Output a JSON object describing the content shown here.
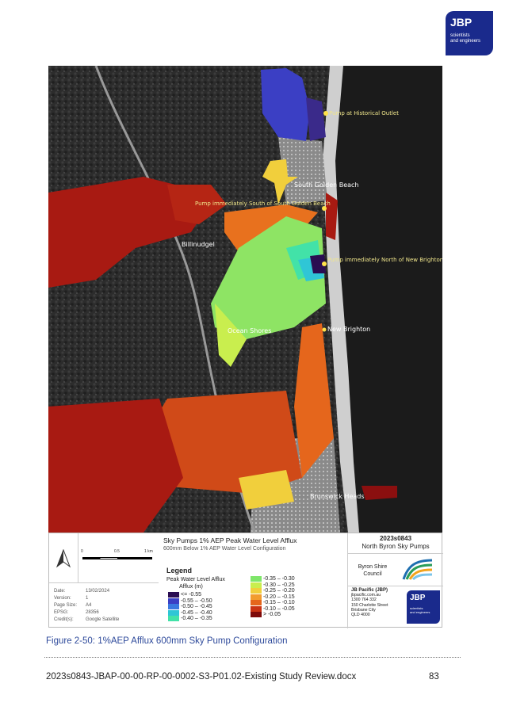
{
  "logo": {
    "big": "JBP",
    "line1": "scientists",
    "line2": "and engineers"
  },
  "map": {
    "place_labels": {
      "pump_historical": "Pump at Historical Outlet",
      "south_golden_beach": "South Golden Beach",
      "pump_south_sgb": "Pump immediately South of South Golden Beach",
      "billinudgel": "Billinudgel",
      "pump_north_nb": "Pump immediately North of New Brighton",
      "ocean_shores": "Ocean Shores",
      "new_brighton": "New Brighton",
      "brunswick_heads": "Brunswick Heads"
    }
  },
  "legend_panel": {
    "scale": {
      "t0": "0",
      "t1": "0.5",
      "t2": "1 km"
    },
    "meta": [
      {
        "k": "Date:",
        "v": "13/02/2024"
      },
      {
        "k": "Version:",
        "v": "1"
      },
      {
        "k": "Page Size:",
        "v": "A4"
      },
      {
        "k": "EPSG:",
        "v": "28356"
      },
      {
        "k": "Credit(s):",
        "v": "Google Satellite"
      }
    ],
    "title": "Sky Pumps 1% AEP Peak Water Level Afflux",
    "subtitle": "600mm Below 1% AEP Water Level Configuration",
    "legend_title": "Legend",
    "legend_sub1": "Peak Water Level Afflux",
    "legend_sub2": "Afflux (m)",
    "classes_left": [
      {
        "label": "<= -0.55",
        "color": "#2a0d52"
      },
      {
        "label": "-0.55 – -0.50",
        "color": "#3b3fc4"
      },
      {
        "label": "-0.50 – -0.45",
        "color": "#3a78e0"
      },
      {
        "label": "-0.45 – -0.40",
        "color": "#2fc6d6"
      },
      {
        "label": "-0.40 – -0.35",
        "color": "#42e2a8"
      }
    ],
    "classes_right": [
      {
        "label": "-0.35 – -0.30",
        "color": "#7fe66a"
      },
      {
        "label": "-0.30 – -0.25",
        "color": "#c9ee4e"
      },
      {
        "label": "-0.25 – -0.20",
        "color": "#f1cf3c"
      },
      {
        "label": "-0.20 – -0.15",
        "color": "#f29c2e"
      },
      {
        "label": "-0.15 – -0.10",
        "color": "#e5661c"
      },
      {
        "label": "-0.10 – -0.05",
        "color": "#c93314"
      },
      {
        "label": "> -0.05",
        "color": "#7e0a0a"
      }
    ],
    "project_number": "2023s0843",
    "project_name": "North Byron Sky Pumps",
    "council_line1": "Byron Shire",
    "council_line2": "Council",
    "jbp": {
      "name": "JB Pacific (JBP)",
      "web": "jbpacific.com.au",
      "phone": "1300 764 332",
      "street": "150 Charlotte Street",
      "city": "Brisbane City",
      "state": "QLD 4000",
      "logo_big": "JBP",
      "logo_l1": "scientists",
      "logo_l2": "and engineers"
    }
  },
  "caption": "Figure 2-50: 1%AEP Afflux 600mm Sky Pump Configuration",
  "footer": {
    "doc": "2023s0843-JBAP-00-00-RP-00-0002-S3-P01.02-Existing Study Review.docx",
    "page": "83"
  }
}
